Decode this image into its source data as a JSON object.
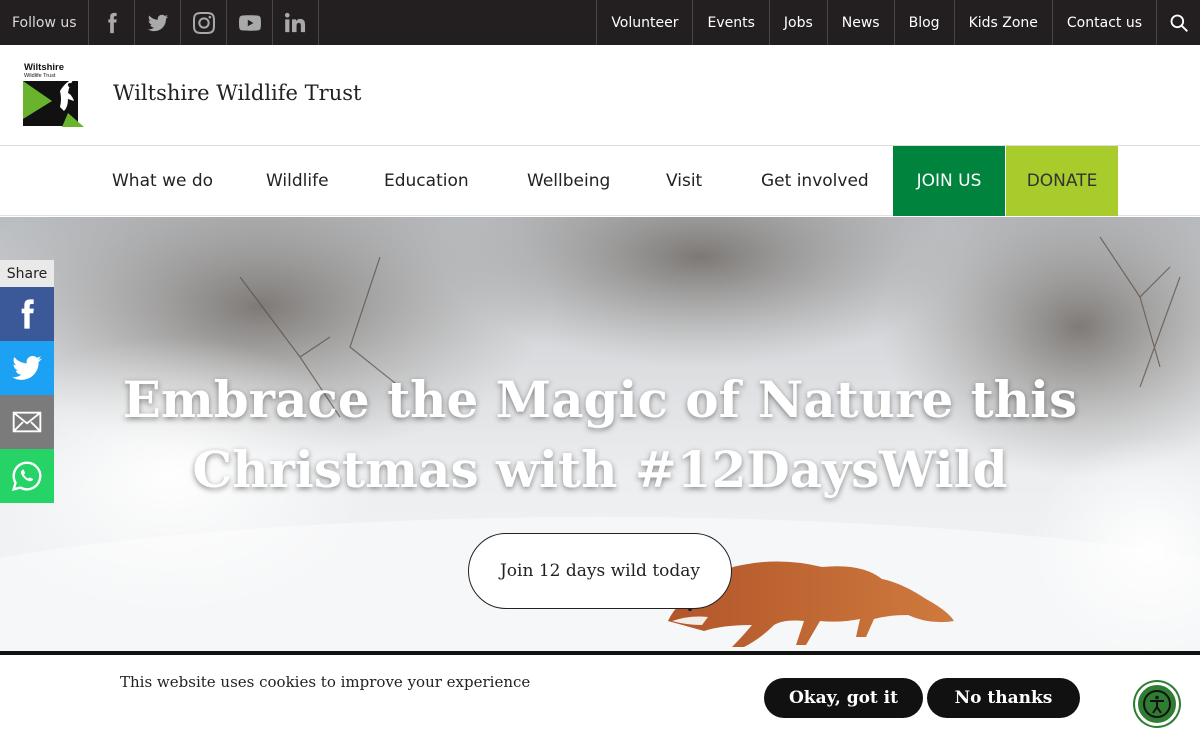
{
  "topbar": {
    "follow_label": "Follow us",
    "social": [
      {
        "icon": "facebook-icon"
      },
      {
        "icon": "twitter-icon"
      },
      {
        "icon": "instagram-icon"
      },
      {
        "icon": "youtube-icon"
      },
      {
        "icon": "linkedin-icon"
      }
    ],
    "links": [
      "Volunteer",
      "Events",
      "Jobs",
      "News",
      "Blog",
      "Kids Zone",
      "Contact us"
    ],
    "search_icon": "search-icon"
  },
  "header": {
    "logo_text_1": "Wiltshire",
    "logo_text_2": "Wildlife Trust",
    "org_name": "Wiltshire Wildlife Trust"
  },
  "nav": {
    "items": [
      "What we do",
      "Wildlife",
      "Education",
      "Wellbeing",
      "Visit",
      "Get involved"
    ],
    "join_label": "JOIN US",
    "donate_label": "DONATE"
  },
  "hero": {
    "title": "Embrace the Magic of Nature this Christmas with #12DaysWild",
    "cta_label": "Join 12 days wild today"
  },
  "share": {
    "label": "Share",
    "buttons": [
      {
        "icon": "facebook-icon",
        "color": "#3b5998"
      },
      {
        "icon": "twitter-icon",
        "color": "#1da1f2"
      },
      {
        "icon": "email-icon",
        "color": "#7b7b7b"
      },
      {
        "icon": "whatsapp-icon",
        "color": "#25d366"
      }
    ]
  },
  "cookie": {
    "message": "This website uses cookies to improve your experience",
    "accept_label": "Okay, got it",
    "decline_label": "No thanks"
  },
  "colors": {
    "topbar": "#231f20",
    "join": "#00843d",
    "donate": "#a8cc2b",
    "accessibility": "#2e7d32"
  }
}
